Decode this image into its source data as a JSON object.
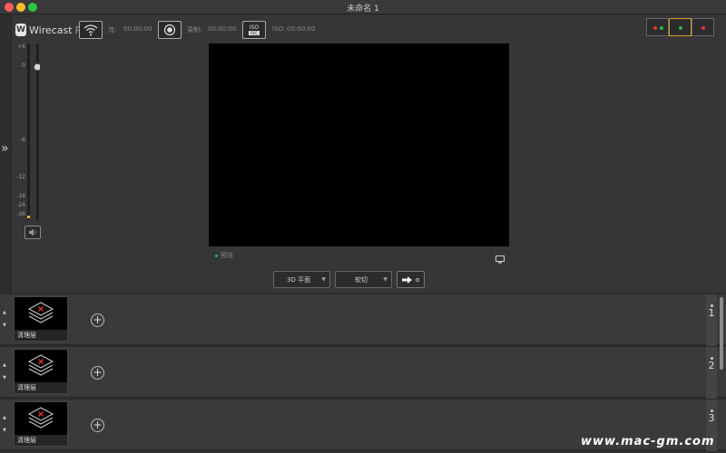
{
  "window": {
    "title": "未命名 1"
  },
  "toolbar": {
    "logo_text": "Wirecast",
    "logo_pro": "Pro",
    "stream_label": "流:",
    "stream_time": "00:00:00",
    "record_label": "录制:",
    "record_time": "00:00:00",
    "iso_label": "ISO:",
    "iso_time": "00:00:00",
    "iso_button_top": "ISO",
    "iso_button_bottom": "REC"
  },
  "audio_meter": {
    "scale": [
      "+6",
      "0",
      "-6",
      "-12",
      "-18",
      "-24",
      "-36"
    ]
  },
  "preview": {
    "label": "预览"
  },
  "transition": {
    "effect": "3D 平面",
    "type": "软切",
    "go_label": "o"
  },
  "layers": [
    {
      "number": "1",
      "thumb_label": "清理层"
    },
    {
      "number": "2",
      "thumb_label": "清理层"
    },
    {
      "number": "3",
      "thumb_label": "清理层"
    }
  ],
  "watermark": "www.mac-gm.com",
  "colors": {
    "accent_selected": "#d6a028",
    "status_green": "#2fb24a",
    "status_red": "#e0352c"
  }
}
